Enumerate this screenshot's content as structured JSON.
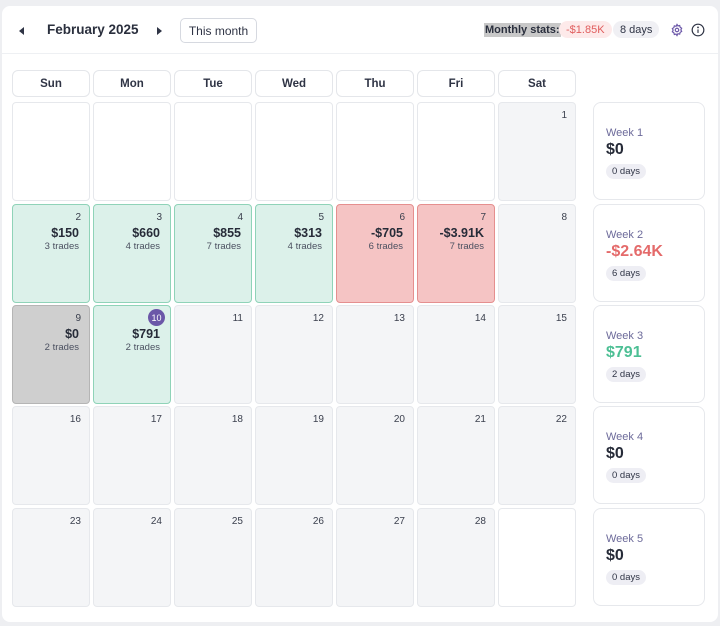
{
  "header": {
    "month_title": "February 2025",
    "this_month_label": "This month",
    "stats_label": "Monthly stats:",
    "stats_value": "-$1.85K",
    "stats_days": "8 days",
    "prev_icon": "caret-left-icon",
    "next_icon": "caret-right-icon",
    "settings_icon": "gear-icon",
    "info_icon": "info-icon"
  },
  "weekdays": [
    "Sun",
    "Mon",
    "Tue",
    "Wed",
    "Thu",
    "Fri",
    "Sat"
  ],
  "days": {
    "d1": {
      "num": "1"
    },
    "d2": {
      "num": "2",
      "pnl": "$150",
      "trades": "3 trades"
    },
    "d3": {
      "num": "3",
      "pnl": "$660",
      "trades": "4 trades"
    },
    "d4": {
      "num": "4",
      "pnl": "$855",
      "trades": "7 trades"
    },
    "d5": {
      "num": "5",
      "pnl": "$313",
      "trades": "4 trades"
    },
    "d6": {
      "num": "6",
      "pnl": "-$705",
      "trades": "6 trades"
    },
    "d7": {
      "num": "7",
      "pnl": "-$3.91K",
      "trades": "7 trades"
    },
    "d8": {
      "num": "8"
    },
    "d9": {
      "num": "9",
      "pnl": "$0",
      "trades": "2 trades"
    },
    "d10": {
      "num": "10",
      "pnl": "$791",
      "trades": "2 trades"
    },
    "d11": {
      "num": "11"
    },
    "d12": {
      "num": "12"
    },
    "d13": {
      "num": "13"
    },
    "d14": {
      "num": "14"
    },
    "d15": {
      "num": "15"
    },
    "d16": {
      "num": "16"
    },
    "d17": {
      "num": "17"
    },
    "d18": {
      "num": "18"
    },
    "d19": {
      "num": "19"
    },
    "d20": {
      "num": "20"
    },
    "d21": {
      "num": "21"
    },
    "d22": {
      "num": "22"
    },
    "d23": {
      "num": "23"
    },
    "d24": {
      "num": "24"
    },
    "d25": {
      "num": "25"
    },
    "d26": {
      "num": "26"
    },
    "d27": {
      "num": "27"
    },
    "d28": {
      "num": "28"
    }
  },
  "weeks": [
    {
      "label": "Week 1",
      "value": "$0",
      "days": "0 days"
    },
    {
      "label": "Week 2",
      "value": "-$2.64K",
      "days": "6 days"
    },
    {
      "label": "Week 3",
      "value": "$791",
      "days": "2 days"
    },
    {
      "label": "Week 4",
      "value": "$0",
      "days": "0 days"
    },
    {
      "label": "Week 5",
      "value": "$0",
      "days": "0 days"
    }
  ],
  "colors": {
    "profit_bg": "#dcf1ea",
    "loss_bg": "#f5c4c4",
    "breakeven_bg": "#cfcfcf",
    "today_badge": "#6b57a8",
    "negative_text": "#e46a6a",
    "positive_text": "#4cbf94"
  }
}
